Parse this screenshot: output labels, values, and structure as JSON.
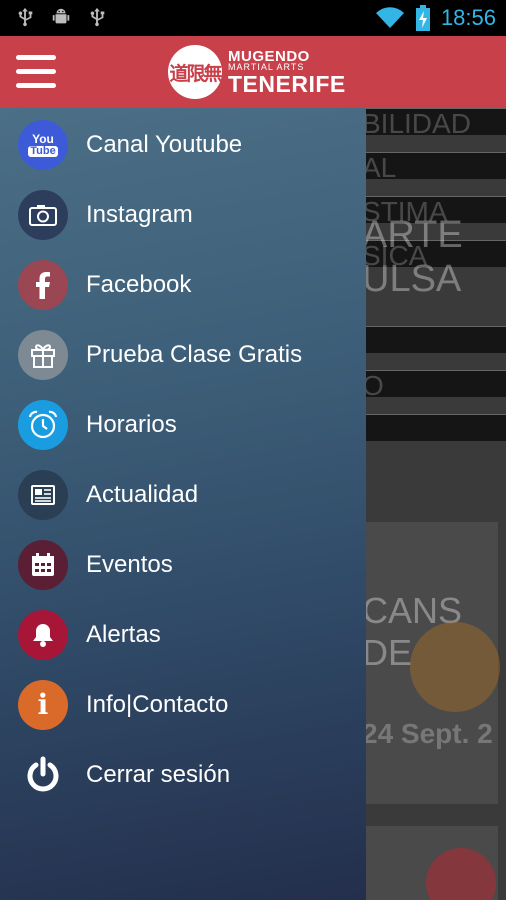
{
  "status_bar": {
    "time": "18:56",
    "icons": [
      "usb-icon",
      "android-debug-icon",
      "usb-icon",
      "wifi-icon",
      "battery-charging-icon"
    ]
  },
  "app_bar": {
    "menu_icon": "hamburger-menu-icon",
    "logo": {
      "emblem_text": "道限無",
      "line1": "MUGENDO",
      "line2": "MARTIAL ARTS",
      "line3": "TENERIFE"
    },
    "color": "#c8414a"
  },
  "drawer": {
    "items": [
      {
        "label": "Canal Youtube",
        "icon": "youtube-icon",
        "icon_bg": "#3d5bd8"
      },
      {
        "label": "Instagram",
        "icon": "camera-icon",
        "icon_bg": "#2d3e5c"
      },
      {
        "label": "Facebook",
        "icon": "facebook-icon",
        "icon_bg": "#9a4753"
      },
      {
        "label": "Prueba Clase Gratis",
        "icon": "gift-icon",
        "icon_bg": "#7d8a93"
      },
      {
        "label": "Horarios",
        "icon": "alarm-clock-icon",
        "icon_bg": "#1a9de0"
      },
      {
        "label": "Actualidad",
        "icon": "newspaper-icon",
        "icon_bg": "#2a3e54"
      },
      {
        "label": "Eventos",
        "icon": "calendar-icon",
        "icon_bg": "#5a1f35"
      },
      {
        "label": "Alertas",
        "icon": "bell-icon",
        "icon_bg": "#a81637"
      },
      {
        "label": "Info|Contacto",
        "icon": "info-icon",
        "icon_bg": "#d96a2a"
      },
      {
        "label": "Cerrar sesión",
        "icon": "power-icon",
        "icon_bg": "transparent"
      }
    ]
  },
  "background_page": {
    "lines": [
      "BILIDAD",
      "AL",
      "STIMA",
      "ARTE",
      "SICA",
      "ULSA",
      "O"
    ],
    "event_card_lines": [
      "CANS",
      "DE",
      "24 Sept. 2"
    ]
  }
}
